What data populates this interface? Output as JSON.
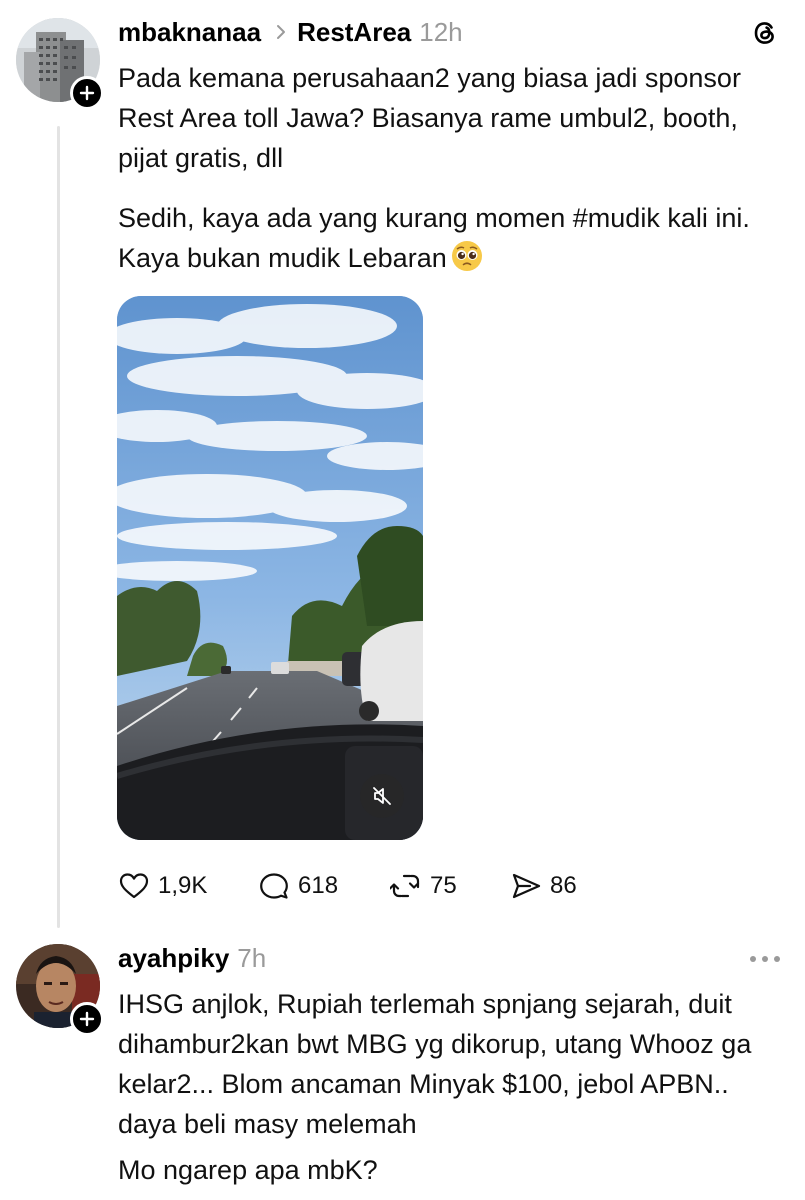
{
  "post": {
    "username": "mbaknanaa",
    "topic": "RestArea",
    "time": "12h",
    "paragraph1": "Pada kemana perusahaan2 yang biasa jadi sponsor Rest Area toll Jawa? Biasanya rame umbul2, booth, pijat gratis, dll",
    "paragraph2": "Sedih, kaya ada yang kurang momen #mudik kali ini. Kaya bukan mudik Lebaran",
    "emoji": "🥺",
    "media": {
      "type": "video",
      "muted": true,
      "description_icon": "speaker-muted-icon"
    },
    "stats": {
      "likes": "1,9K",
      "replies": "618",
      "reposts": "75",
      "shares": "86"
    }
  },
  "reply": {
    "username": "ayahpiky",
    "time": "7h",
    "paragraph1": "IHSG anjlok, Rupiah terlemah spnjang sejarah, duit dihambur2kan bwt MBG yg dikorup, utang Whooz ga kelar2... Blom ancaman Minyak $100, jebol APBN.. daya beli masy melemah",
    "paragraph2": "Mo ngarep apa mbK?"
  },
  "icons": {
    "app": "threads-logo-icon",
    "like": "heart-icon",
    "reply": "comment-bubble-icon",
    "repost": "repost-arrows-icon",
    "share": "send-icon",
    "more": "more-options-icon",
    "follow": "plus-icon"
  },
  "colors": {
    "text": "#000000",
    "muted": "#9a9a9a",
    "thread_line": "#e3e3e3"
  }
}
